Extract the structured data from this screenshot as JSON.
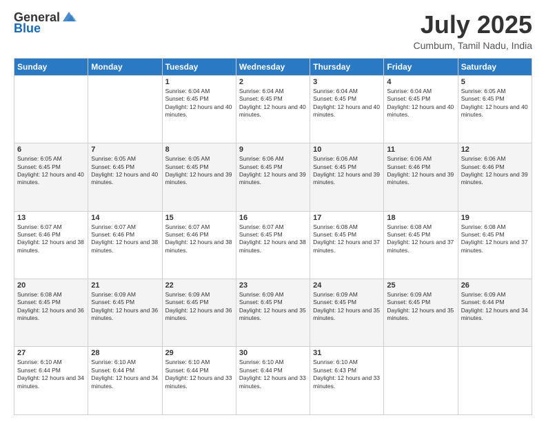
{
  "logo": {
    "general": "General",
    "blue": "Blue"
  },
  "title": "July 2025",
  "subtitle": "Cumbum, Tamil Nadu, India",
  "days_of_week": [
    "Sunday",
    "Monday",
    "Tuesday",
    "Wednesday",
    "Thursday",
    "Friday",
    "Saturday"
  ],
  "weeks": [
    [
      {
        "day": "",
        "info": ""
      },
      {
        "day": "",
        "info": ""
      },
      {
        "day": "1",
        "info": "Sunrise: 6:04 AM\nSunset: 6:45 PM\nDaylight: 12 hours and 40 minutes."
      },
      {
        "day": "2",
        "info": "Sunrise: 6:04 AM\nSunset: 6:45 PM\nDaylight: 12 hours and 40 minutes."
      },
      {
        "day": "3",
        "info": "Sunrise: 6:04 AM\nSunset: 6:45 PM\nDaylight: 12 hours and 40 minutes."
      },
      {
        "day": "4",
        "info": "Sunrise: 6:04 AM\nSunset: 6:45 PM\nDaylight: 12 hours and 40 minutes."
      },
      {
        "day": "5",
        "info": "Sunrise: 6:05 AM\nSunset: 6:45 PM\nDaylight: 12 hours and 40 minutes."
      }
    ],
    [
      {
        "day": "6",
        "info": "Sunrise: 6:05 AM\nSunset: 6:45 PM\nDaylight: 12 hours and 40 minutes."
      },
      {
        "day": "7",
        "info": "Sunrise: 6:05 AM\nSunset: 6:45 PM\nDaylight: 12 hours and 40 minutes."
      },
      {
        "day": "8",
        "info": "Sunrise: 6:05 AM\nSunset: 6:45 PM\nDaylight: 12 hours and 39 minutes."
      },
      {
        "day": "9",
        "info": "Sunrise: 6:06 AM\nSunset: 6:45 PM\nDaylight: 12 hours and 39 minutes."
      },
      {
        "day": "10",
        "info": "Sunrise: 6:06 AM\nSunset: 6:45 PM\nDaylight: 12 hours and 39 minutes."
      },
      {
        "day": "11",
        "info": "Sunrise: 6:06 AM\nSunset: 6:46 PM\nDaylight: 12 hours and 39 minutes."
      },
      {
        "day": "12",
        "info": "Sunrise: 6:06 AM\nSunset: 6:46 PM\nDaylight: 12 hours and 39 minutes."
      }
    ],
    [
      {
        "day": "13",
        "info": "Sunrise: 6:07 AM\nSunset: 6:46 PM\nDaylight: 12 hours and 38 minutes."
      },
      {
        "day": "14",
        "info": "Sunrise: 6:07 AM\nSunset: 6:46 PM\nDaylight: 12 hours and 38 minutes."
      },
      {
        "day": "15",
        "info": "Sunrise: 6:07 AM\nSunset: 6:46 PM\nDaylight: 12 hours and 38 minutes."
      },
      {
        "day": "16",
        "info": "Sunrise: 6:07 AM\nSunset: 6:45 PM\nDaylight: 12 hours and 38 minutes."
      },
      {
        "day": "17",
        "info": "Sunrise: 6:08 AM\nSunset: 6:45 PM\nDaylight: 12 hours and 37 minutes."
      },
      {
        "day": "18",
        "info": "Sunrise: 6:08 AM\nSunset: 6:45 PM\nDaylight: 12 hours and 37 minutes."
      },
      {
        "day": "19",
        "info": "Sunrise: 6:08 AM\nSunset: 6:45 PM\nDaylight: 12 hours and 37 minutes."
      }
    ],
    [
      {
        "day": "20",
        "info": "Sunrise: 6:08 AM\nSunset: 6:45 PM\nDaylight: 12 hours and 36 minutes."
      },
      {
        "day": "21",
        "info": "Sunrise: 6:09 AM\nSunset: 6:45 PM\nDaylight: 12 hours and 36 minutes."
      },
      {
        "day": "22",
        "info": "Sunrise: 6:09 AM\nSunset: 6:45 PM\nDaylight: 12 hours and 36 minutes."
      },
      {
        "day": "23",
        "info": "Sunrise: 6:09 AM\nSunset: 6:45 PM\nDaylight: 12 hours and 35 minutes."
      },
      {
        "day": "24",
        "info": "Sunrise: 6:09 AM\nSunset: 6:45 PM\nDaylight: 12 hours and 35 minutes."
      },
      {
        "day": "25",
        "info": "Sunrise: 6:09 AM\nSunset: 6:45 PM\nDaylight: 12 hours and 35 minutes."
      },
      {
        "day": "26",
        "info": "Sunrise: 6:09 AM\nSunset: 6:44 PM\nDaylight: 12 hours and 34 minutes."
      }
    ],
    [
      {
        "day": "27",
        "info": "Sunrise: 6:10 AM\nSunset: 6:44 PM\nDaylight: 12 hours and 34 minutes."
      },
      {
        "day": "28",
        "info": "Sunrise: 6:10 AM\nSunset: 6:44 PM\nDaylight: 12 hours and 34 minutes."
      },
      {
        "day": "29",
        "info": "Sunrise: 6:10 AM\nSunset: 6:44 PM\nDaylight: 12 hours and 33 minutes."
      },
      {
        "day": "30",
        "info": "Sunrise: 6:10 AM\nSunset: 6:44 PM\nDaylight: 12 hours and 33 minutes."
      },
      {
        "day": "31",
        "info": "Sunrise: 6:10 AM\nSunset: 6:43 PM\nDaylight: 12 hours and 33 minutes."
      },
      {
        "day": "",
        "info": ""
      },
      {
        "day": "",
        "info": ""
      }
    ]
  ]
}
